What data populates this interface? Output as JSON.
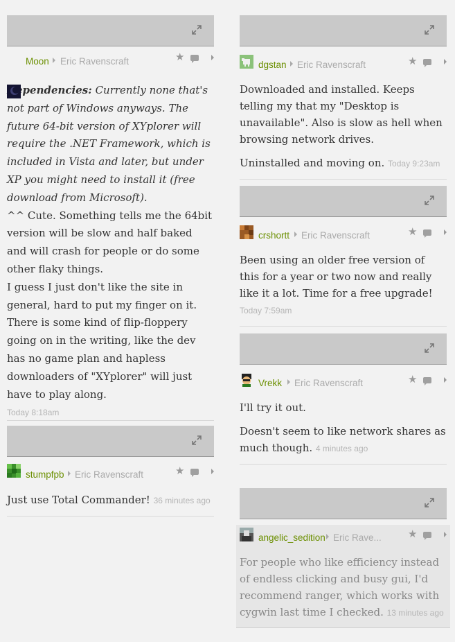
{
  "comments": {
    "moon": {
      "user": "Moon",
      "reply_to": "Eric Ravenscraft",
      "body_lead": "Dependencies:",
      "body_italic": " Currently none that's not part of Windows anyways. The future 64-bit version of XYplorer will require the .NET Framework, which is included in Vista and later, but under XP you might need to install it (free download from Microsoft).",
      "body_p2": "^^ Cute. Something tells me the 64bit version will be slow and half baked and will crash for people or do some other flaky things.",
      "body_p3": "I guess I just don't like the site in general, hard to put my finger on it. There is some kind of flip-floppery going on in the writing, like the dev has no game plan and hapless downloaders of \"XYplorer\" will just have to play along.",
      "time": "Today 8:18am"
    },
    "stumpfpb": {
      "user": "stumpfpb",
      "reply_to": "Eric Ravenscraft",
      "body": "Just use Total Commander!",
      "time": "36 minutes ago"
    },
    "dgstan": {
      "user": "dgstan",
      "reply_to": "Eric Ravenscraft",
      "body_p1": "Downloaded and installed. Keeps telling my that my \"Desktop is unavailable\". Also is slow as hell when browsing network drives.",
      "body_p2": "Uninstalled and moving on.",
      "time": "Today 9:23am"
    },
    "crshortt": {
      "user": "crshortt",
      "reply_to": "Eric Ravenscraft",
      "body": "Been using an older free version of this for a year or two now and really like it a lot. Time for a free upgrade!",
      "time": "Today 7:59am"
    },
    "vrekk": {
      "user": "Vrekk",
      "reply_to": "Eric Ravenscraft",
      "body_p1": "I'll try it out.",
      "body_p2": "Doesn't seem to like network shares as much though.",
      "time": "4 minutes ago"
    },
    "angelic": {
      "user": "angelic_sedition",
      "reply_to": "Eric Rave...",
      "body": "For people who like efficiency instead of endless clicking and busy gui, I'd recommend ranger, which works with cygwin last time I checked.",
      "time": "13 minutes ago"
    }
  },
  "colors": {
    "username": "#6b8f00",
    "muted": "#aaaaaa",
    "media_placeholder": "#c9c9c9"
  },
  "icons": [
    "expand-icon",
    "reply-arrow-icon",
    "star-icon",
    "comment-bubble-icon",
    "chevron-right-icon"
  ]
}
